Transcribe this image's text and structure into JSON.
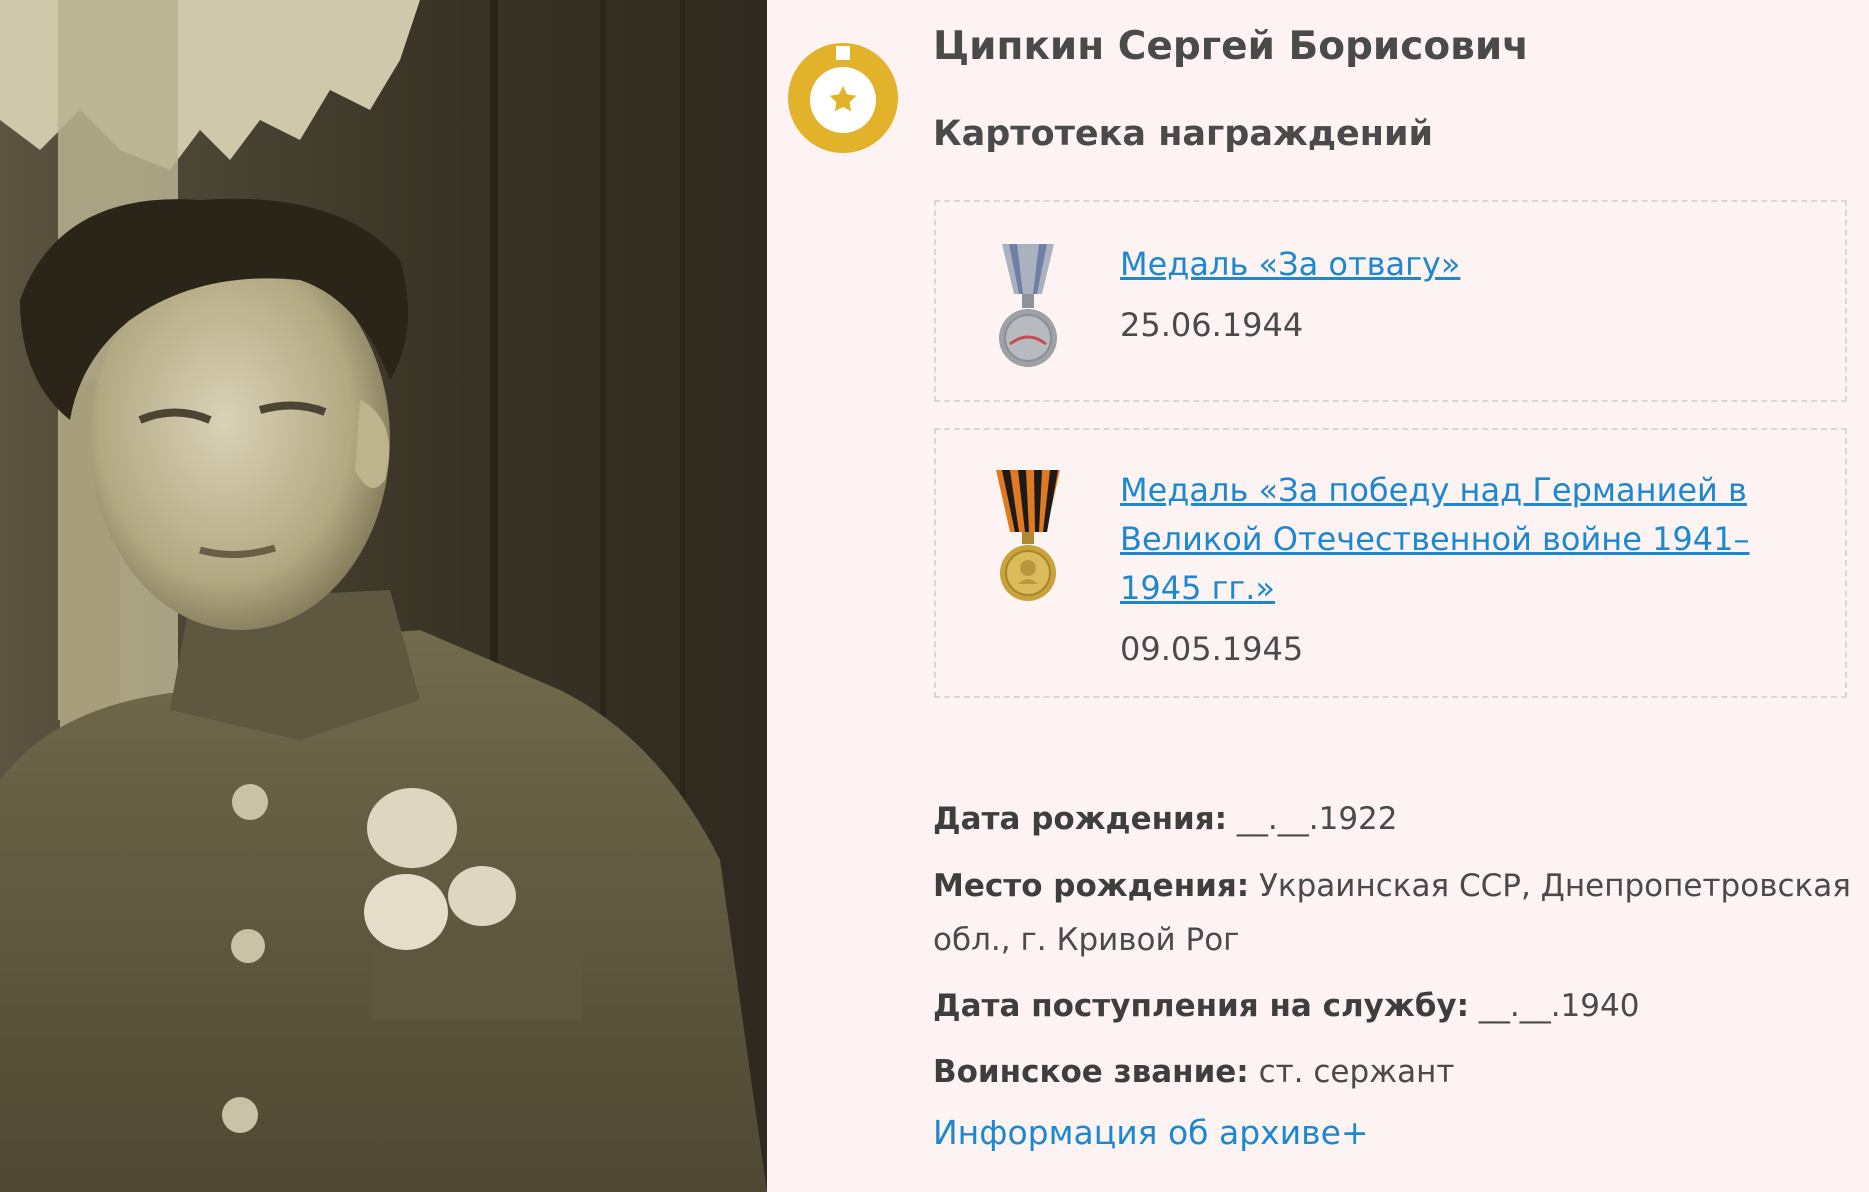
{
  "person": {
    "name": "Ципкин Сергей Борисович",
    "section_title": "Картотека награждений"
  },
  "awards": [
    {
      "title": "Медаль «За отвагу»",
      "date": "25.06.1944",
      "medal_icon": "medal-for-courage-icon"
    },
    {
      "title": "Медаль «За победу над Германией в Великой Отечественной войне 1941–1945 гг.»",
      "date": "09.05.1945",
      "medal_icon": "medal-victory-over-germany-icon"
    }
  ],
  "info": {
    "birth_date_label": "Дата рождения:",
    "birth_date_value": "__.__.1922",
    "birth_place_label": "Место рождения:",
    "birth_place_value": "Украинская ССР, Днепропетровская обл., г. Кривой Рог",
    "service_date_label": "Дата поступления на службу:",
    "service_date_value": "__.__.1940",
    "rank_label": "Воинское звание:",
    "rank_value": "ст. сержант"
  },
  "archive_link": "Информация об архиве+",
  "colors": {
    "link": "#1d88d0",
    "badge_gold": "#e2b22a",
    "background": "#fdf3f2",
    "text": "#4a4a4a"
  }
}
